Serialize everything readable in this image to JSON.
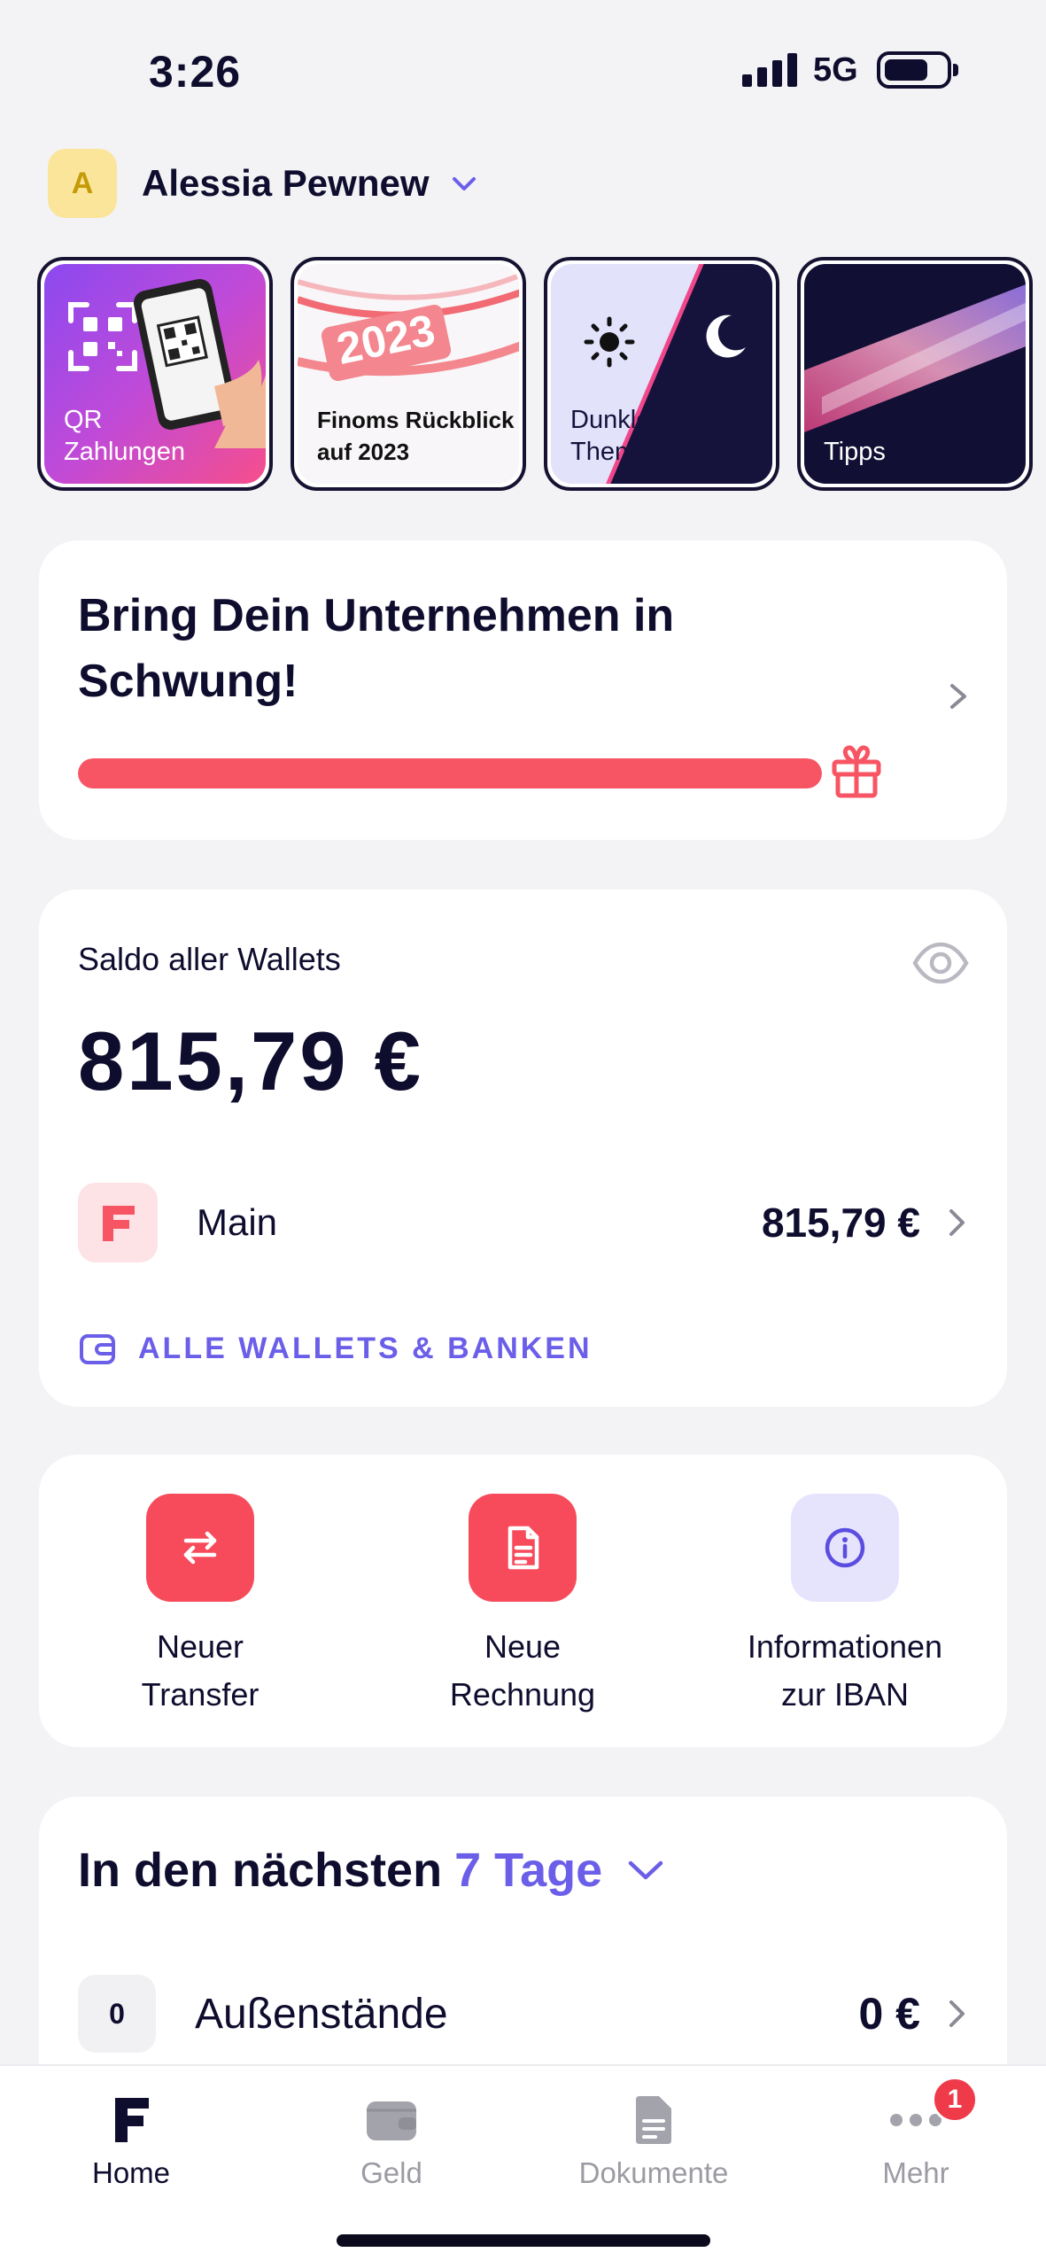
{
  "status_bar": {
    "time": "3:26",
    "network": "5G"
  },
  "account": {
    "initial": "A",
    "name": "Alessia Pewnew"
  },
  "stories": [
    {
      "label": "QR\nZahlungen"
    },
    {
      "label": "Finoms Rückblick\nauf 2023",
      "art_text": "2023"
    },
    {
      "label": "Dunkles\nThema im Web"
    },
    {
      "label": "Tipps"
    }
  ],
  "onboarding": {
    "title": "Bring Dein Unternehmen in Schwung!",
    "progress": 1.0
  },
  "balance": {
    "label": "Saldo aller Wallets",
    "amount": "815,79 €",
    "wallet": {
      "name": "Main",
      "amount": "815,79 €"
    },
    "all_wallets_label": "ALLE WALLETS & BANKEN"
  },
  "actions": [
    {
      "label": "Neuer\nTransfer",
      "icon": "transfer-icon",
      "color": "#f74b5b"
    },
    {
      "label": "Neue\nRechnung",
      "icon": "invoice-icon",
      "color": "#f74b5b"
    },
    {
      "label": "Informationen\nzur IBAN",
      "icon": "info-icon",
      "color": "#e6e4fd"
    }
  ],
  "upcoming": {
    "title": "In den nächsten",
    "period": "7 Tage",
    "rows": [
      {
        "count": "0",
        "label": "Außenstände",
        "amount": "0 €"
      }
    ]
  },
  "tabbar": {
    "tabs": [
      {
        "label": "Home",
        "icon": "home-logo-icon",
        "active": true
      },
      {
        "label": "Geld",
        "icon": "wallet-icon",
        "active": false
      },
      {
        "label": "Dokumente",
        "icon": "document-icon",
        "active": false
      },
      {
        "label": "Mehr",
        "icon": "more-icon",
        "active": false,
        "badge": "1"
      }
    ]
  },
  "colors": {
    "accent": "#6b5ee8",
    "brand_red": "#f75563",
    "text": "#0f0d2e"
  }
}
